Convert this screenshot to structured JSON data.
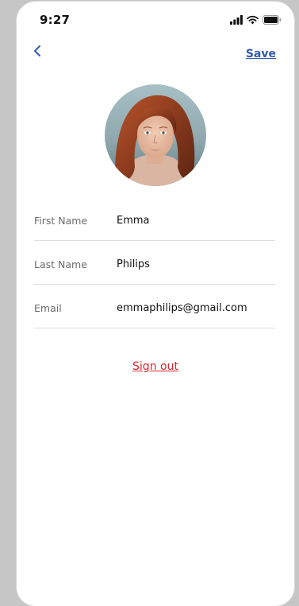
{
  "status_bar": {
    "time": "9:27",
    "signal_icon": "signal-bars-icon",
    "wifi_icon": "wifi-icon",
    "battery_icon": "battery-icon"
  },
  "nav": {
    "back_icon": "chevron-left-icon",
    "save_label": "Save"
  },
  "profile": {
    "avatar": "profile-photo"
  },
  "form": {
    "rows": [
      {
        "label": "First Name",
        "value": "Emma"
      },
      {
        "label": "Last Name",
        "value": "Philips"
      },
      {
        "label": "Email",
        "value": "emmaphilips@gmail.com"
      }
    ]
  },
  "actions": {
    "sign_out_label": "Sign out"
  },
  "colors": {
    "accent": "#2f5bb0",
    "danger": "#e0252a",
    "background": "#c6c6c6",
    "card": "#ffffff"
  }
}
